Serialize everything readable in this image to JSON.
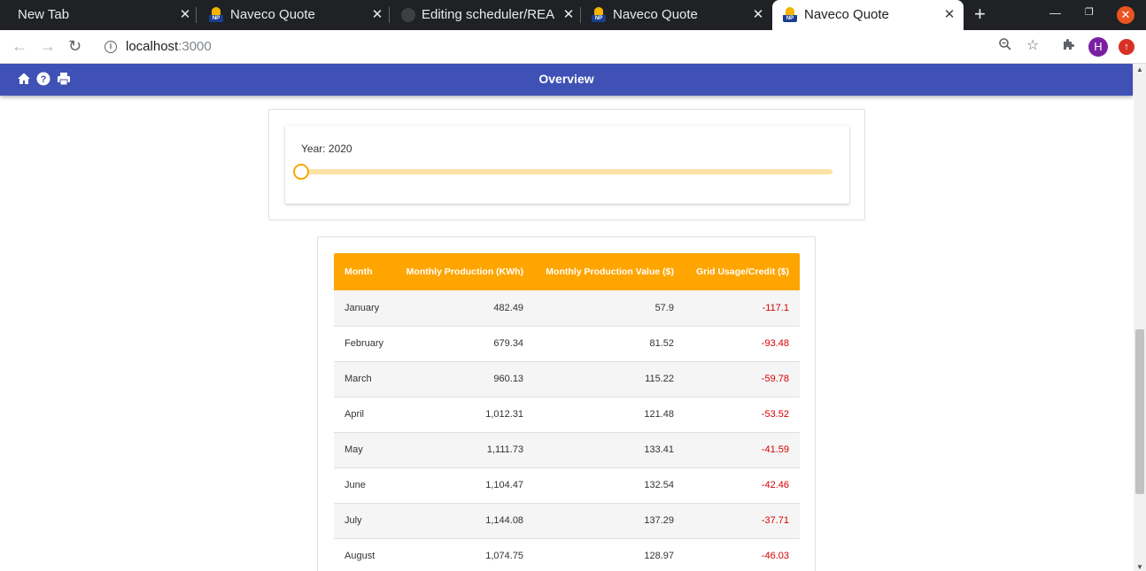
{
  "browser": {
    "tabs": [
      {
        "title": "New Tab",
        "favicon": "none"
      },
      {
        "title": "Naveco Quote",
        "favicon": "naveco-icon"
      },
      {
        "title": "Editing scheduler/REA",
        "favicon": "github-icon"
      },
      {
        "title": "Naveco Quote",
        "favicon": "naveco-icon"
      },
      {
        "title": "Naveco Quote",
        "favicon": "naveco-icon",
        "active": true
      }
    ],
    "new_tab_label": "+",
    "url_host": "localhost",
    "url_port": ":3000",
    "profile_initial": "H"
  },
  "app": {
    "title": "Overview",
    "icons": [
      "home-icon",
      "help-icon",
      "print-icon"
    ],
    "theme_color": "#3f51b5",
    "accent_color": "#ffa500"
  },
  "year_selector": {
    "label": "Year: 2020",
    "value": 2020,
    "slider_fraction": 0
  },
  "table": {
    "headers": [
      "Month",
      "Monthly Production (KWh)",
      "Monthly Production Value ($)",
      "Grid Usage/Credit ($)"
    ],
    "rows": [
      [
        "January",
        "482.49",
        "57.9",
        "-117.1"
      ],
      [
        "February",
        "679.34",
        "81.52",
        "-93.48"
      ],
      [
        "March",
        "960.13",
        "115.22",
        "-59.78"
      ],
      [
        "April",
        "1,012.31",
        "121.48",
        "-53.52"
      ],
      [
        "May",
        "1,111.73",
        "133.41",
        "-41.59"
      ],
      [
        "June",
        "1,104.47",
        "132.54",
        "-42.46"
      ],
      [
        "July",
        "1,144.08",
        "137.29",
        "-37.71"
      ],
      [
        "August",
        "1,074.75",
        "128.97",
        "-46.03"
      ]
    ]
  }
}
